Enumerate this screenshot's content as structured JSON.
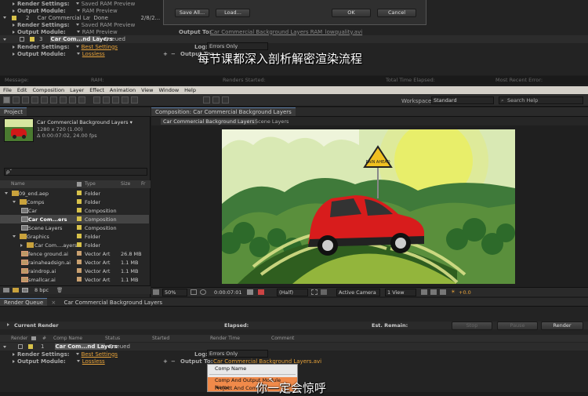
{
  "top_rq": {
    "rows": [
      {
        "label": "Render Settings:",
        "value": "Saved RAM Preview"
      },
      {
        "label": "Output Module:",
        "value": "RAM Preview"
      },
      {
        "num": "2",
        "name": "Car Commercial Layers",
        "status": "Done",
        "started": "2/8/2..."
      },
      {
        "label": "Render Settings:",
        "value": "Saved RAM Preview"
      },
      {
        "label": "Output Module:",
        "value": "RAM Preview"
      },
      {
        "num": "3",
        "name": "Car Com...nd Layers",
        "status": "Queued"
      },
      {
        "label": "Render Settings:",
        "value": "Best Settings"
      },
      {
        "label": "Output Module:",
        "value": "Lossless"
      }
    ],
    "log_label": "Log:",
    "log_value": "Errors Only",
    "output_to_label": "Output To:",
    "output_to_value": "Car Commercial Background Layers RAM_lowquality.avi",
    "output_to_label2": "Output To:"
  },
  "dialog": {
    "save_all": "Save All...",
    "load": "Load...",
    "ok": "OK",
    "cancel": "Cancel"
  },
  "caption_top": "每节课都深入剖析解密渲染流程",
  "info_bar": {
    "message": "Message:",
    "ram": "RAM:",
    "renders_started": "Renders Started:",
    "total_time": "Total Time Elapsed:",
    "recent_error": "Most Recent Error:"
  },
  "menu": [
    "File",
    "Edit",
    "Composition",
    "Layer",
    "Effect",
    "Animation",
    "View",
    "Window",
    "Help"
  ],
  "toolbar": {
    "workspace_label": "Workspace:",
    "workspace_value": "Standard",
    "search_placeholder": "Search Help"
  },
  "project": {
    "tab": "Project",
    "comp_name": "Car Commercial Background Layers ▾",
    "comp_res": "1280 x 720 (1.00)",
    "comp_dur": "Δ 0:00:07:02, 24.00 fps",
    "search_placeholder": "ρˇ",
    "cols": {
      "name": "Name",
      "type": "Type",
      "size": "Size",
      "fr": "Fr"
    },
    "items": [
      {
        "name": "09_end.aep",
        "type": "Folder",
        "size": "",
        "indent": 0,
        "icon": "folder",
        "open": true
      },
      {
        "name": "Comps",
        "type": "Folder",
        "size": "",
        "indent": 1,
        "icon": "folder",
        "open": true
      },
      {
        "name": "Car",
        "type": "Composition",
        "size": "",
        "indent": 2,
        "icon": "comp"
      },
      {
        "name": "Car Com...ers",
        "type": "Composition",
        "size": "",
        "indent": 2,
        "icon": "comp",
        "selected": true
      },
      {
        "name": "Scene Layers",
        "type": "Composition",
        "size": "",
        "indent": 2,
        "icon": "comp"
      },
      {
        "name": "Graphics",
        "type": "Folder",
        "size": "",
        "indent": 1,
        "icon": "folder",
        "open": true
      },
      {
        "name": "Car Com....ayers",
        "type": "Folder",
        "size": "",
        "indent": 2,
        "icon": "folder"
      },
      {
        "name": "fence ground.ai",
        "type": "Vector Art",
        "size": "26.8 MB",
        "indent": 2,
        "icon": "ai"
      },
      {
        "name": "rainaheadsign.ai",
        "type": "Vector Art",
        "size": "1.1 MB",
        "indent": 2,
        "icon": "ai"
      },
      {
        "name": "raindrop.ai",
        "type": "Vector Art",
        "size": "1.1 MB",
        "indent": 2,
        "icon": "ai"
      },
      {
        "name": "smallcar.ai",
        "type": "Vector Art",
        "size": "1.1 MB",
        "indent": 2,
        "icon": "ai"
      }
    ],
    "bpc": "8 bpc"
  },
  "composition": {
    "tab": "Composition: Car Commercial Background Layers",
    "subtab1": "Car Commercial Background Layers",
    "subtab2": "Scene Layers",
    "sign_text": "RAIN AHEAD",
    "zoom": "50%",
    "timecode": "0:00:07:01",
    "resolution": "(Half)",
    "camera": "Active Camera",
    "view": "1 View",
    "exposure": "+0.0"
  },
  "render_queue": {
    "tab1": "Render Queue",
    "tab2": "Car Commercial Background Layers",
    "current_render": "Current Render",
    "elapsed": "Elapsed:",
    "est_remain": "Est. Remain:",
    "stop": "Stop",
    "pause": "Pause",
    "render": "Render",
    "cols": {
      "render": "Render",
      "comp_name": "Comp Name",
      "status": "Status",
      "started": "Started",
      "render_time": "Render Time",
      "comment": "Comment"
    },
    "item": {
      "num": "1",
      "name": "Car Com...nd Layers",
      "status": "Queued"
    },
    "render_settings_label": "Render Settings:",
    "render_settings_value": "Best Settings",
    "output_module_label": "Output Module:",
    "output_module_value": "Lossless",
    "log_label": "Log:",
    "log_value": "Errors Only",
    "output_to_label": "Output To:",
    "output_to_value": "Car Commercial Background Layers.avi"
  },
  "dropdown": [
    "Comp Name",
    "Comp And Output Module Name",
    "Project And Comp..."
  ],
  "caption_bottom": "你一定会惊呼"
}
